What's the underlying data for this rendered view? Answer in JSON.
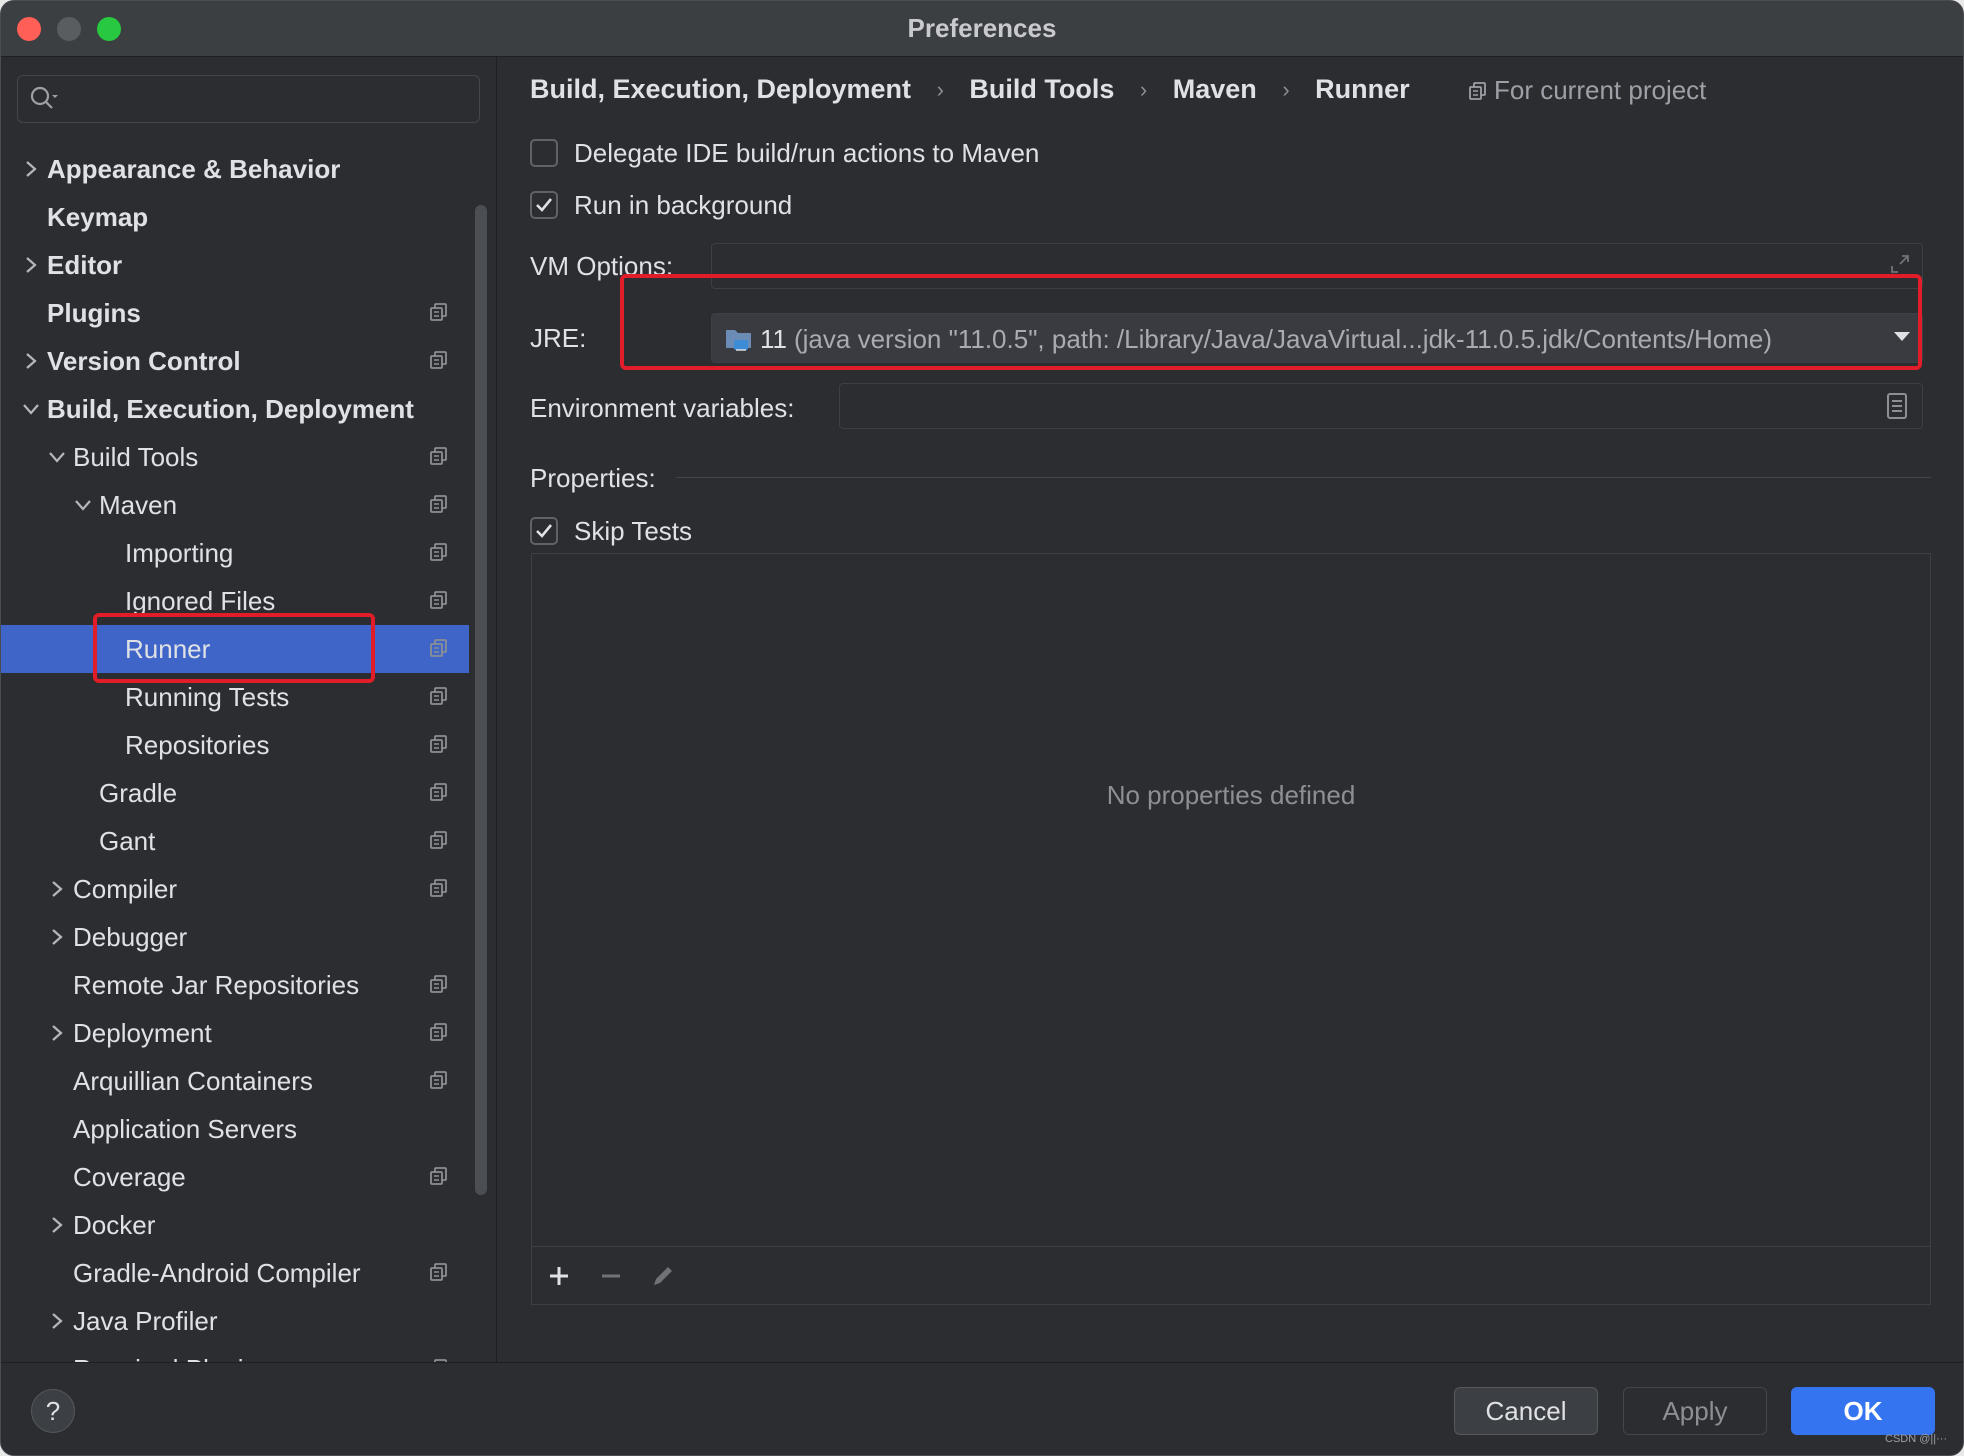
{
  "window": {
    "title": "Preferences"
  },
  "search": {
    "placeholder": ""
  },
  "tree": [
    {
      "label": "Appearance & Behavior",
      "indent": 0,
      "chevron": "right",
      "bold": true,
      "scope": false
    },
    {
      "label": "Keymap",
      "indent": 0,
      "chevron": "none",
      "bold": true,
      "scope": false
    },
    {
      "label": "Editor",
      "indent": 0,
      "chevron": "right",
      "bold": true,
      "scope": false
    },
    {
      "label": "Plugins",
      "indent": 0,
      "chevron": "none",
      "bold": true,
      "scope": true
    },
    {
      "label": "Version Control",
      "indent": 0,
      "chevron": "right",
      "bold": true,
      "scope": true
    },
    {
      "label": "Build, Execution, Deployment",
      "indent": 0,
      "chevron": "down",
      "bold": true,
      "scope": false
    },
    {
      "label": "Build Tools",
      "indent": 1,
      "chevron": "down",
      "bold": false,
      "scope": true
    },
    {
      "label": "Maven",
      "indent": 2,
      "chevron": "down",
      "bold": false,
      "scope": true
    },
    {
      "label": "Importing",
      "indent": 3,
      "chevron": "none",
      "bold": false,
      "scope": true
    },
    {
      "label": "Ignored Files",
      "indent": 3,
      "chevron": "none",
      "bold": false,
      "scope": true
    },
    {
      "label": "Runner",
      "indent": 3,
      "chevron": "none",
      "bold": false,
      "scope": true,
      "selected": true
    },
    {
      "label": "Running Tests",
      "indent": 3,
      "chevron": "none",
      "bold": false,
      "scope": true
    },
    {
      "label": "Repositories",
      "indent": 3,
      "chevron": "none",
      "bold": false,
      "scope": true
    },
    {
      "label": "Gradle",
      "indent": 2,
      "chevron": "none",
      "bold": false,
      "scope": true
    },
    {
      "label": "Gant",
      "indent": 2,
      "chevron": "none",
      "bold": false,
      "scope": true
    },
    {
      "label": "Compiler",
      "indent": 1,
      "chevron": "right",
      "bold": false,
      "scope": true
    },
    {
      "label": "Debugger",
      "indent": 1,
      "chevron": "right",
      "bold": false,
      "scope": false
    },
    {
      "label": "Remote Jar Repositories",
      "indent": 1,
      "chevron": "none",
      "bold": false,
      "scope": true
    },
    {
      "label": "Deployment",
      "indent": 1,
      "chevron": "right",
      "bold": false,
      "scope": true
    },
    {
      "label": "Arquillian Containers",
      "indent": 1,
      "chevron": "none",
      "bold": false,
      "scope": true
    },
    {
      "label": "Application Servers",
      "indent": 1,
      "chevron": "none",
      "bold": false,
      "scope": false
    },
    {
      "label": "Coverage",
      "indent": 1,
      "chevron": "none",
      "bold": false,
      "scope": true
    },
    {
      "label": "Docker",
      "indent": 1,
      "chevron": "right",
      "bold": false,
      "scope": false
    },
    {
      "label": "Gradle-Android Compiler",
      "indent": 1,
      "chevron": "none",
      "bold": false,
      "scope": true
    },
    {
      "label": "Java Profiler",
      "indent": 1,
      "chevron": "right",
      "bold": false,
      "scope": false
    },
    {
      "label": "Required Plugins",
      "indent": 1,
      "chevron": "none",
      "bold": false,
      "scope": true
    }
  ],
  "breadcrumb": [
    "Build, Execution, Deployment",
    "Build Tools",
    "Maven",
    "Runner"
  ],
  "scope_label": "For current project",
  "options": {
    "delegate": {
      "label": "Delegate IDE build/run actions to Maven",
      "checked": false
    },
    "background": {
      "label": "Run in background",
      "checked": true
    }
  },
  "vm_options": {
    "label": "VM Options:",
    "value": ""
  },
  "jre": {
    "label": "JRE:",
    "version": "11",
    "detail": "(java version \"11.0.5\", path: /Library/Java/JavaVirtual...jdk-11.0.5.jdk/Contents/Home)"
  },
  "env": {
    "label": "Environment variables:",
    "value": ""
  },
  "properties": {
    "label": "Properties:",
    "skip_tests": {
      "label": "Skip Tests",
      "checked": true
    },
    "empty_text": "No properties defined"
  },
  "buttons": {
    "cancel": "Cancel",
    "apply": "Apply",
    "ok": "OK",
    "help": "?"
  },
  "watermark": "CSDN @||···",
  "colors": {
    "accent": "#3574f0",
    "selection": "#3f65c8",
    "highlight": "#e21d2a"
  }
}
